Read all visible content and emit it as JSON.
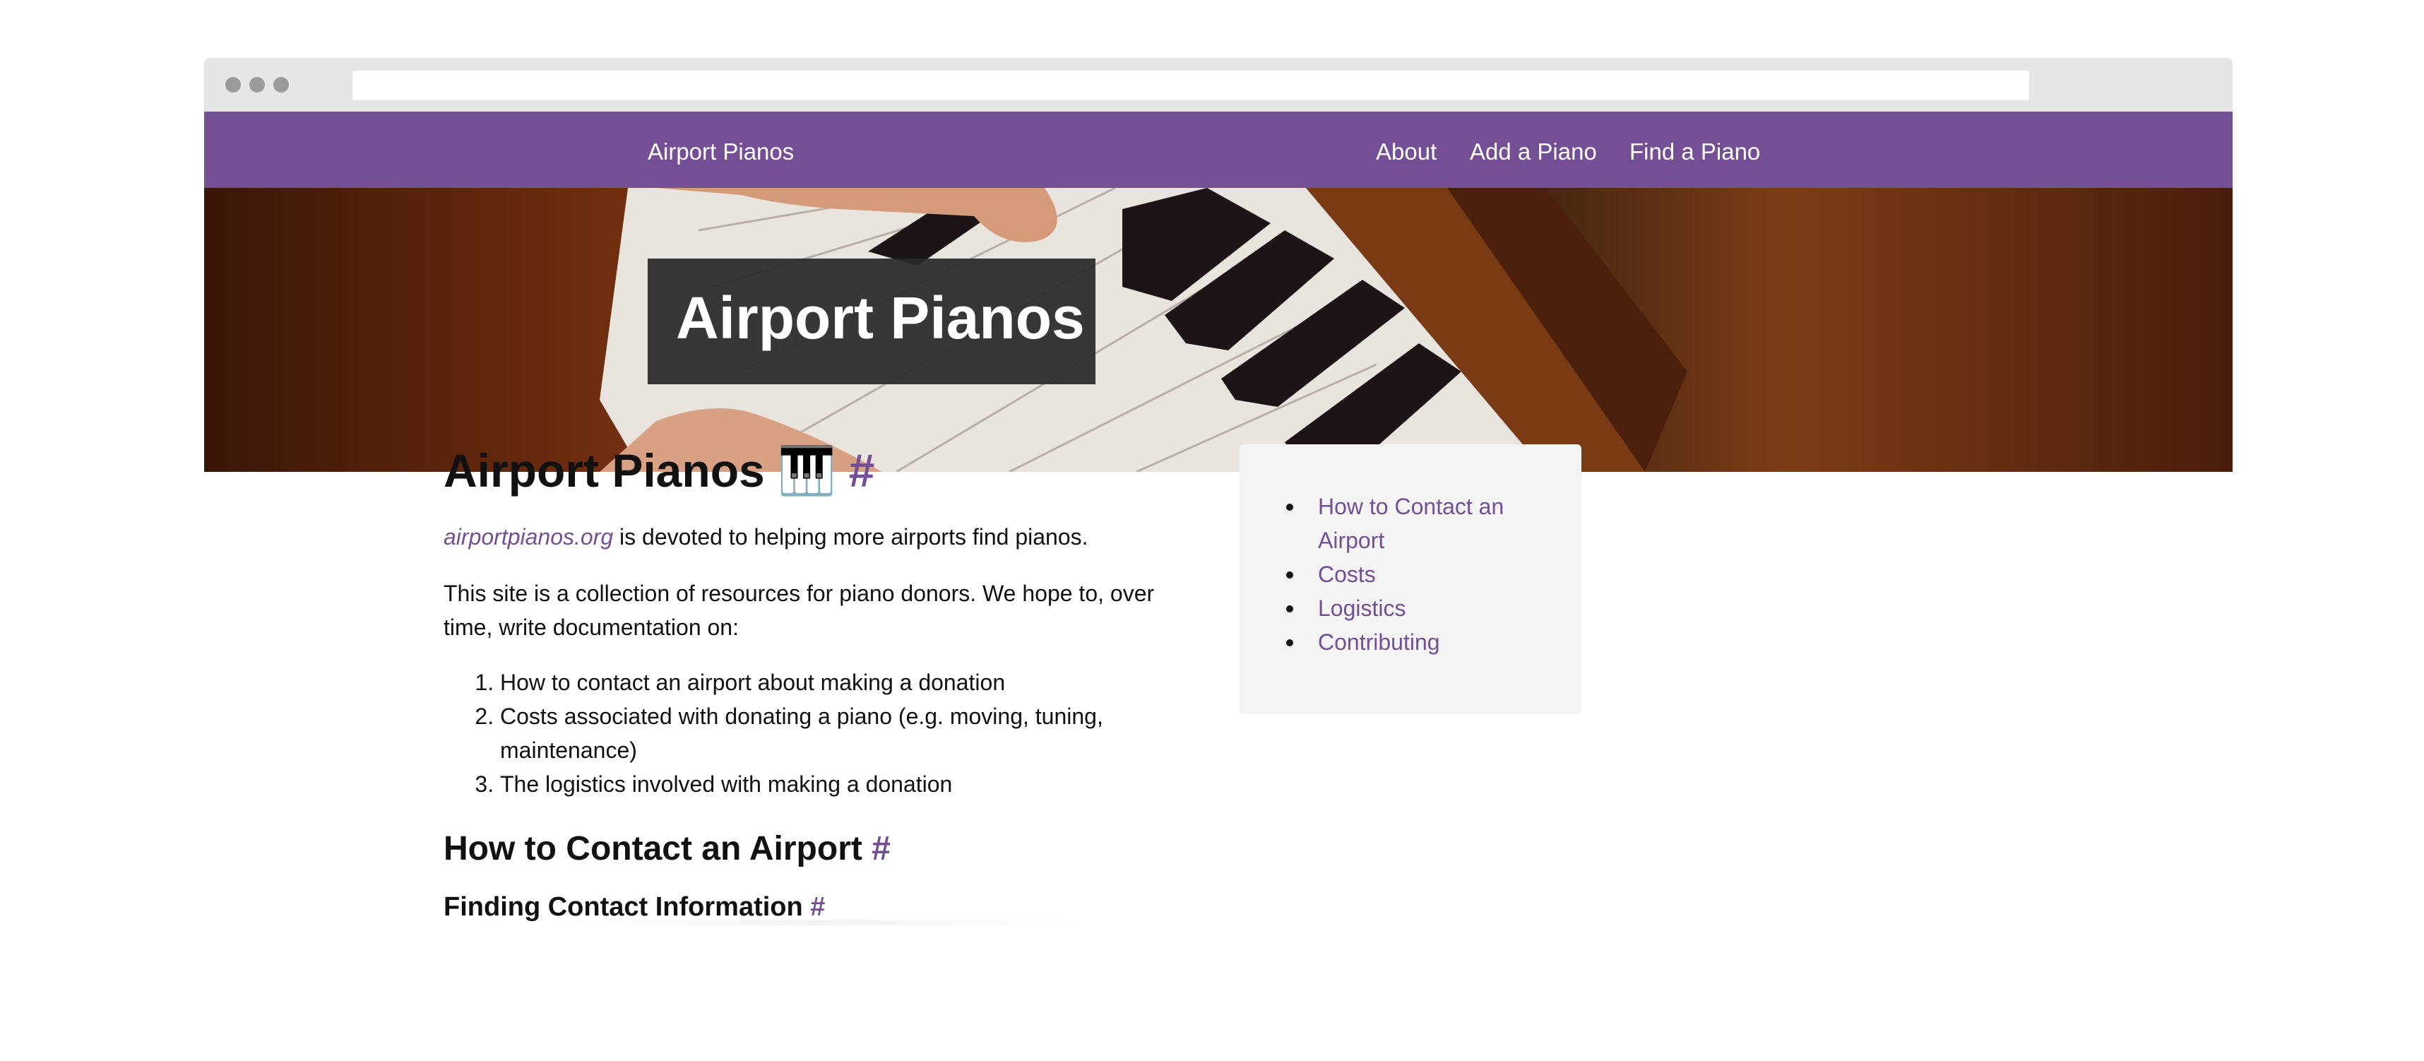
{
  "browser": {
    "url": ""
  },
  "navbar": {
    "brand": "Airport Pianos",
    "links": [
      "About",
      "Add a Piano",
      "Find a Piano"
    ],
    "color": "#744f95"
  },
  "hero": {
    "title": "Airport Pianos"
  },
  "main": {
    "title": "Airport Pianos",
    "title_emoji": "🎹",
    "anchor": "#",
    "intro_link": "airportpianos.org",
    "intro_rest": " is devoted to helping more airports find pianos.",
    "paragraph2": "This site is a collection of resources for piano donors. We hope to, over time, write documentation on:",
    "list": [
      "How to contact an airport about making a donation",
      "Costs associated with donating a piano (e.g. moving, tuning, maintenance)",
      "The logistics involved with making a donation"
    ],
    "section_heading": "How to Contact an Airport",
    "subsection_heading": "Finding Contact Information"
  },
  "toc": {
    "items": [
      "How to Contact an Airport",
      "Costs",
      "Logistics",
      "Contributing"
    ]
  }
}
